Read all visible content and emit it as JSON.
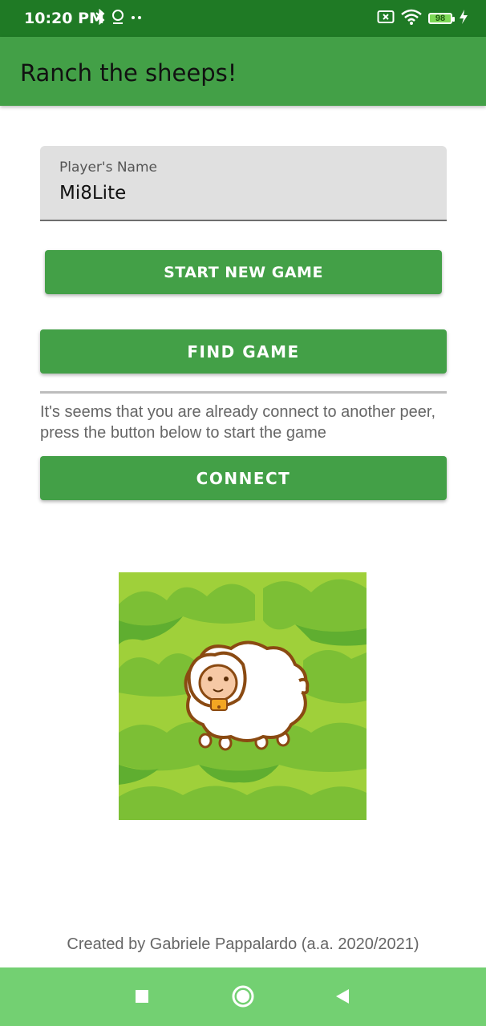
{
  "status_bar": {
    "time": "10:20 PM",
    "battery_level": "98",
    "icons_left": [
      "bluetooth-icon",
      "location-icon",
      "more-dots-icon"
    ],
    "icons_right": [
      "sim-off-icon",
      "wifi-icon",
      "battery-icon",
      "charging-icon"
    ]
  },
  "app_bar": {
    "title": "Ranch the sheeps!"
  },
  "form": {
    "name_label": "Player's Name",
    "name_value": "Mi8Lite"
  },
  "buttons": {
    "start_new_game": "START NEW GAME",
    "find_game": "FIND GAME",
    "connect": "CONNECT"
  },
  "info_text": "It's seems that you are already connect to another peer, press the button below to start the game",
  "image": {
    "subject": "sheep-on-grass-illustration"
  },
  "footer": {
    "credits": "Created by Gabriele Pappalardo (a.a. 2020/2021)"
  },
  "nav_bar": {
    "buttons": [
      "recents-square-icon",
      "home-circle-icon",
      "back-triangle-icon"
    ]
  },
  "colors": {
    "status_bar": "#1f7a25",
    "primary": "#43a047",
    "nav_bar": "#73d072",
    "field_bg": "#e0e0e0"
  }
}
